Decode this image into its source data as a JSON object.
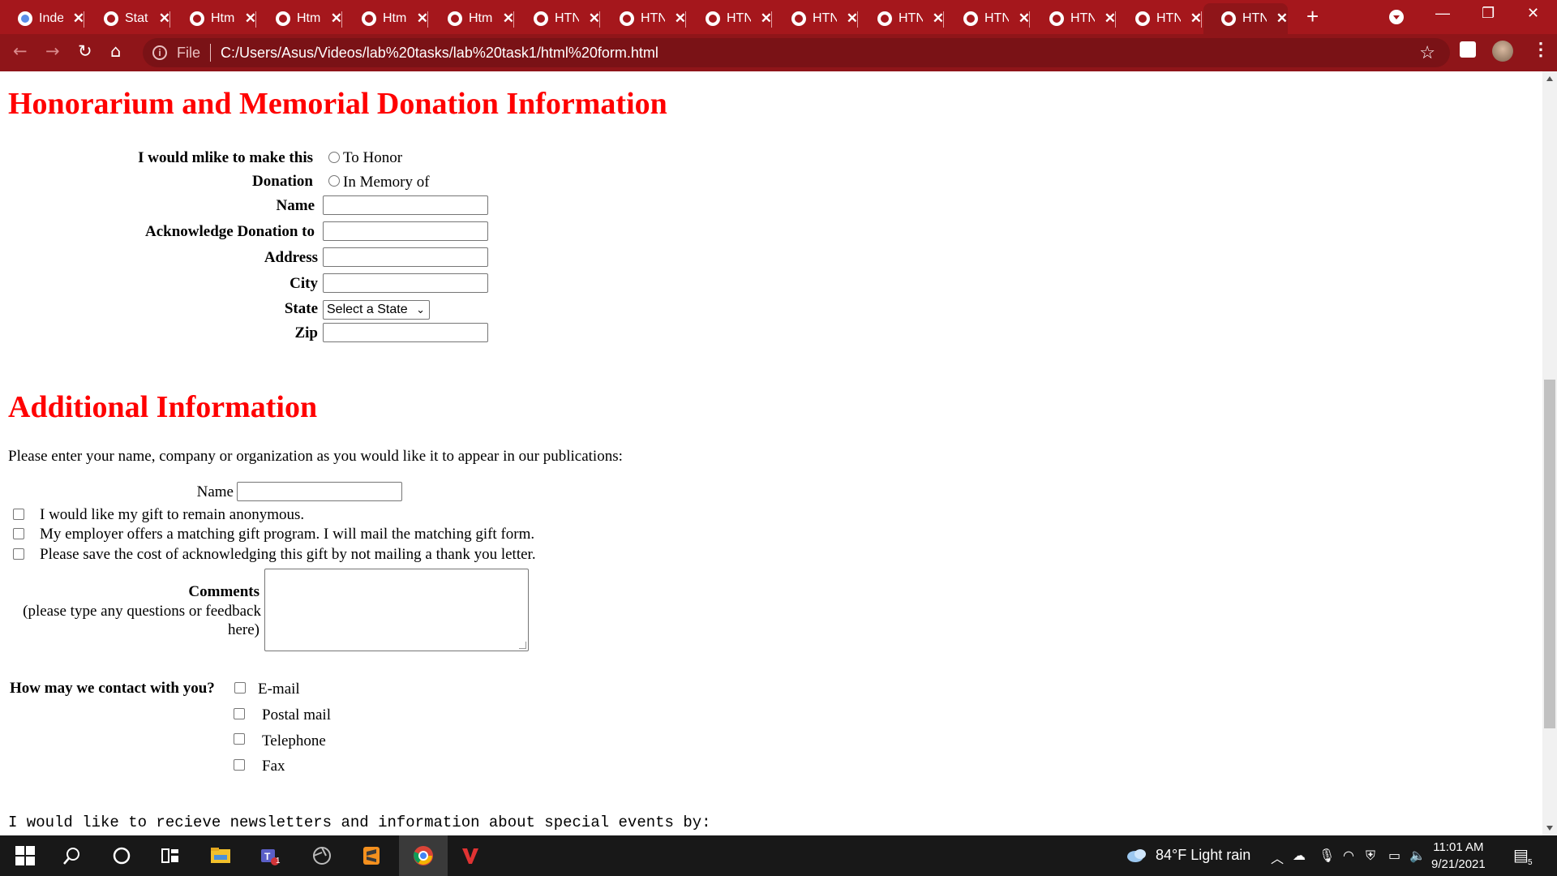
{
  "browser": {
    "tabs": [
      {
        "label": "Inde",
        "active": false
      },
      {
        "label": "Stat",
        "active": false
      },
      {
        "label": "Htm",
        "active": false
      },
      {
        "label": "Htm",
        "active": false
      },
      {
        "label": "Htm",
        "active": false
      },
      {
        "label": "Htm",
        "active": false
      },
      {
        "label": "HTN",
        "active": false
      },
      {
        "label": "HTN",
        "active": false
      },
      {
        "label": "HTN",
        "active": false
      },
      {
        "label": "HTN",
        "active": false
      },
      {
        "label": "HTN",
        "active": false
      },
      {
        "label": "HTN",
        "active": false
      },
      {
        "label": "HTN",
        "active": false
      },
      {
        "label": "HTN",
        "active": false
      },
      {
        "label": "HTN",
        "active": true
      }
    ],
    "new_tab": "+",
    "address": {
      "scheme_label": "File",
      "url": "C:/Users/Asus/Videos/lab%20tasks/lab%20task1/html%20form.html"
    },
    "accent_color": "#a5171c"
  },
  "page": {
    "honorarium": {
      "heading": "Honorarium and Memorial Donation Information",
      "make_label_1": "I would mlike to make this",
      "make_label_2": "Donation",
      "option_honor": "To Honor",
      "option_memory": "In Memory of",
      "name_label": "Name",
      "ack_label": "Acknowledge Donation to",
      "address_label": "Address",
      "city_label": "City",
      "state_label": "State",
      "state_value": "Select a State",
      "zip_label": "Zip"
    },
    "additional": {
      "heading": "Additional Information",
      "intro": "Please enter your name, company or organization as you would like it to appear in our publications:",
      "name_label": "Name",
      "check_anonymous": "I would like my gift to remain anonymous.",
      "check_employer": "My employer offers a matching gift program. I will mail the matching gift form.",
      "check_save": "Please save the cost of acknowledging this gift by not mailing a thank you letter.",
      "comments_label": "Comments",
      "comments_hint_1": "(please type any questions or feedback",
      "comments_hint_2": "here)",
      "contact_label": "How may we contact with you?",
      "contact_options": [
        "E-mail",
        "Postal mail",
        "Telephone",
        "Fax"
      ],
      "newsletter": "I would like to recieve newsletters and information about special events by:"
    },
    "heading_color": "#ff0000"
  },
  "taskbar": {
    "weather": "84°F  Light rain",
    "time": "11:01 AM",
    "date": "9/21/2021",
    "notifications": "5",
    "teams_badge": "1"
  }
}
